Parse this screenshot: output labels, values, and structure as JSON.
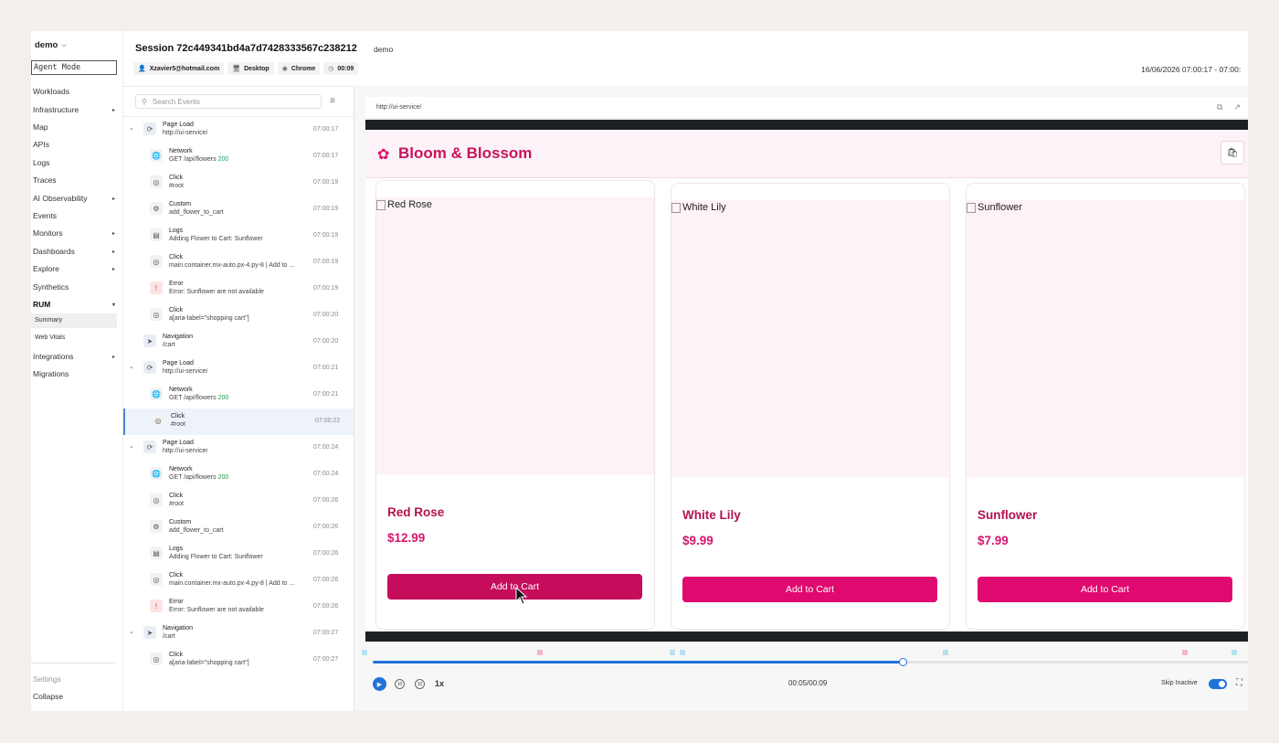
{
  "nav": {
    "org": "demo",
    "agent_mode": "Agent Mode",
    "items": [
      {
        "label": "Workloads",
        "arrow": ""
      },
      {
        "label": "Infrastructure",
        "arrow": "▸"
      },
      {
        "label": "Map",
        "arrow": ""
      },
      {
        "label": "APIs",
        "arrow": ""
      },
      {
        "label": "Logs",
        "arrow": ""
      },
      {
        "label": "Traces",
        "arrow": ""
      },
      {
        "label": "AI Observability",
        "arrow": "▸"
      },
      {
        "label": "Events",
        "arrow": ""
      },
      {
        "label": "Monitors",
        "arrow": "▸"
      },
      {
        "label": "Dashboards",
        "arrow": "▸"
      },
      {
        "label": "Explore",
        "arrow": "▸"
      },
      {
        "label": "Synthetics",
        "arrow": ""
      },
      {
        "label": "RUM",
        "arrow": "▾"
      }
    ],
    "rum_sub": [
      "Summary",
      "Web Vitals"
    ],
    "items2": [
      {
        "label": "Integrations",
        "arrow": "▸"
      },
      {
        "label": "Migrations",
        "arrow": ""
      }
    ],
    "settings": "Settings",
    "collapse": "Collapse"
  },
  "header": {
    "title": "Session 72c449341bd4a7d7428333567c238212",
    "org": "demo",
    "user": "Xzavier5@hotmail.com",
    "device": "Desktop",
    "browser": "Chrome",
    "duration": "00:09",
    "date": "16/06/2026 07:00:17 - 07:00:"
  },
  "events": {
    "search_placeholder": "Search Events",
    "items": [
      {
        "type": "Page Load",
        "detail": "http://ui-service/",
        "time": "07:00:17",
        "level": 0,
        "icon": "reload-icon",
        "glyph": "⟳",
        "caret": true,
        "status": "",
        "kind": "load"
      },
      {
        "type": "Network",
        "detail": "GET /api/flowers ",
        "time": "07:00:17",
        "level": 1,
        "icon": "globe-icon",
        "glyph": "🌐",
        "caret": false,
        "status": "200",
        "kind": "plain"
      },
      {
        "type": "Click",
        "detail": "#root",
        "time": "07:00:19",
        "level": 1,
        "icon": "click-icon",
        "glyph": "◎",
        "caret": false,
        "status": "",
        "kind": "plain"
      },
      {
        "type": "Custom",
        "detail": "add_flower_to_cart",
        "time": "07:00:19",
        "level": 1,
        "icon": "gear-icon",
        "glyph": "⚙",
        "caret": false,
        "status": "",
        "kind": "plain"
      },
      {
        "type": "Logs",
        "detail": "Adding Flower to Cart: Sunflower",
        "time": "07:00:19",
        "level": 1,
        "icon": "log-icon",
        "glyph": "▤",
        "caret": false,
        "status": "",
        "kind": "plain"
      },
      {
        "type": "Click",
        "detail": "main.container.mx-auto.px-4.py-8 | Add to ...",
        "time": "07:00:19",
        "level": 1,
        "icon": "click-icon",
        "glyph": "◎",
        "caret": false,
        "status": "",
        "kind": "plain"
      },
      {
        "type": "Error",
        "detail": "Error: Sunflower are not available",
        "time": "07:00:19",
        "level": 1,
        "icon": "error-icon",
        "glyph": "!",
        "caret": false,
        "status": "",
        "kind": "err"
      },
      {
        "type": "Click",
        "detail": "a[aria-label=\"shopping cart\"]",
        "time": "07:00:20",
        "level": 1,
        "icon": "click-icon",
        "glyph": "◎",
        "caret": false,
        "status": "",
        "kind": "plain"
      },
      {
        "type": "Navigation",
        "detail": "/cart",
        "time": "07:00:20",
        "level": 0,
        "icon": "navigation-icon",
        "glyph": "➤",
        "caret": false,
        "status": "",
        "kind": "load"
      },
      {
        "type": "Page Load",
        "detail": "http://ui-service/",
        "time": "07:00:21",
        "level": 0,
        "icon": "reload-icon",
        "glyph": "⟳",
        "caret": true,
        "status": "",
        "kind": "load"
      },
      {
        "type": "Network",
        "detail": "GET /api/flowers ",
        "time": "07:00:21",
        "level": 1,
        "icon": "globe-icon",
        "glyph": "🌐",
        "caret": false,
        "status": "200",
        "kind": "plain"
      },
      {
        "type": "Click",
        "detail": "#root",
        "time": "07:00:22",
        "level": 1,
        "icon": "click-icon",
        "glyph": "◎",
        "caret": false,
        "status": "",
        "kind": "plain",
        "selected": true
      },
      {
        "type": "Page Load",
        "detail": "http://ui-service/",
        "time": "07:00:24",
        "level": 0,
        "icon": "reload-icon",
        "glyph": "⟳",
        "caret": true,
        "status": "",
        "kind": "load"
      },
      {
        "type": "Network",
        "detail": "GET /api/flowers ",
        "time": "07:00:24",
        "level": 1,
        "icon": "globe-icon",
        "glyph": "🌐",
        "caret": false,
        "status": "200",
        "kind": "plain"
      },
      {
        "type": "Click",
        "detail": "#root",
        "time": "07:00:26",
        "level": 1,
        "icon": "click-icon",
        "glyph": "◎",
        "caret": false,
        "status": "",
        "kind": "plain"
      },
      {
        "type": "Custom",
        "detail": "add_flower_to_cart",
        "time": "07:00:26",
        "level": 1,
        "icon": "gear-icon",
        "glyph": "⚙",
        "caret": false,
        "status": "",
        "kind": "plain"
      },
      {
        "type": "Logs",
        "detail": "Adding Flower to Cart: Sunflower",
        "time": "07:00:26",
        "level": 1,
        "icon": "log-icon",
        "glyph": "▤",
        "caret": false,
        "status": "",
        "kind": "plain"
      },
      {
        "type": "Click",
        "detail": "main.container.mx-auto.px-4.py-8 | Add to ...",
        "time": "07:00:26",
        "level": 1,
        "icon": "click-icon",
        "glyph": "◎",
        "caret": false,
        "status": "",
        "kind": "plain"
      },
      {
        "type": "Error",
        "detail": "Error: Sunflower are not available",
        "time": "07:00:26",
        "level": 1,
        "icon": "error-icon",
        "glyph": "!",
        "caret": false,
        "status": "",
        "kind": "err"
      },
      {
        "type": "Navigation",
        "detail": "/cart",
        "time": "07:00:27",
        "level": 0,
        "icon": "navigation-icon",
        "glyph": "➤",
        "caret": true,
        "status": "",
        "kind": "load"
      },
      {
        "type": "Click",
        "detail": "a[aria-label=\"shopping cart\"]",
        "time": "07:00:27",
        "level": 1,
        "icon": "click-icon",
        "glyph": "◎",
        "caret": false,
        "status": "",
        "kind": "plain"
      }
    ]
  },
  "player": {
    "url": "http://ui-service/",
    "brand": "Bloom & Blossom",
    "products": [
      {
        "alt": "Red Rose",
        "name": "Red Rose",
        "price": "$12.99",
        "button": "Add to Cart"
      },
      {
        "alt": "White Lily",
        "name": "White Lily",
        "price": "$9.99",
        "button": "Add to Cart"
      },
      {
        "alt": "Sunflower",
        "name": "Sunflower",
        "price": "$7.99",
        "button": "Add to Cart"
      }
    ],
    "progress": 0.605,
    "speed": "1x",
    "time": "00:05/00:09",
    "skip_inactive": "Skip Inactive",
    "skip_inactive_on": true,
    "colors": {
      "accent": "#1f73d8",
      "brand": "#d6156e",
      "marker_click": "#b8e2ee",
      "marker_error": "#f6b6c8"
    }
  }
}
